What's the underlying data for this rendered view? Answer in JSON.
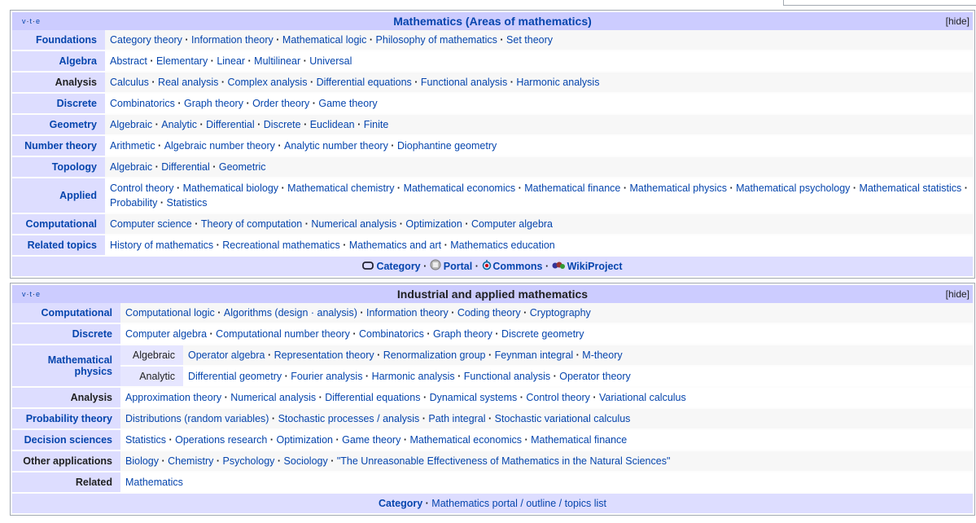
{
  "box1": {
    "vte": [
      "v",
      "t",
      "e"
    ],
    "title_link": "Mathematics",
    "title_rest": " (Areas of mathematics)",
    "hide": "[hide]",
    "rows": [
      {
        "group": "Foundations",
        "group_link": true,
        "items": [
          "Category theory",
          "Information theory",
          "Mathematical logic",
          "Philosophy of mathematics",
          "Set theory"
        ]
      },
      {
        "group": "Algebra",
        "group_link": true,
        "items": [
          "Abstract",
          "Elementary",
          "Linear",
          "Multilinear",
          "Universal"
        ]
      },
      {
        "group": "Analysis",
        "group_link": false,
        "items": [
          "Calculus",
          "Real analysis",
          "Complex analysis",
          "Differential equations",
          "Functional analysis",
          "Harmonic analysis"
        ]
      },
      {
        "group": "Discrete",
        "group_link": true,
        "items": [
          "Combinatorics",
          "Graph theory",
          "Order theory",
          "Game theory"
        ]
      },
      {
        "group": "Geometry",
        "group_link": true,
        "items": [
          "Algebraic",
          "Analytic",
          "Differential",
          "Discrete",
          "Euclidean",
          "Finite"
        ]
      },
      {
        "group": "Number theory",
        "group_link": true,
        "items": [
          "Arithmetic",
          "Algebraic number theory",
          "Analytic number theory",
          "Diophantine geometry"
        ]
      },
      {
        "group": "Topology",
        "group_link": true,
        "items": [
          "Algebraic",
          "Differential",
          "Geometric"
        ]
      },
      {
        "group": "Applied",
        "group_link": true,
        "items": [
          "Control theory",
          "Mathematical biology",
          "Mathematical chemistry",
          "Mathematical economics",
          "Mathematical finance",
          "Mathematical physics",
          "Mathematical psychology",
          "Mathematical statistics",
          "Probability",
          "Statistics"
        ]
      },
      {
        "group": "Computational",
        "group_link": true,
        "items": [
          "Computer science",
          "Theory of computation",
          "Numerical analysis",
          "Optimization",
          "Computer algebra"
        ]
      },
      {
        "group": "Related topics",
        "group_link": true,
        "items": [
          "History of mathematics",
          "Recreational mathematics",
          "Mathematics and art",
          "Mathematics education"
        ]
      }
    ],
    "footer": {
      "category": "Category",
      "portal": "Portal",
      "commons": "Commons",
      "wikiproject": "WikiProject"
    }
  },
  "box2": {
    "vte": [
      "v",
      "t",
      "e"
    ],
    "title": "Industrial and applied mathematics",
    "hide": "[hide]",
    "rows": [
      {
        "group": "Computational",
        "group_link": true,
        "items": [
          "Computational logic",
          "Algorithms (design · analysis)",
          "Information theory",
          "Coding theory",
          "Cryptography"
        ]
      },
      {
        "group": "Discrete",
        "group_link": true,
        "items": [
          "Computer algebra",
          "Computational number theory",
          "Combinatorics",
          "Graph theory",
          "Discrete geometry"
        ]
      },
      {
        "group": "Mathematical physics",
        "group_link": true,
        "subrows": [
          {
            "label": "Algebraic",
            "items": [
              "Operator algebra",
              "Representation theory",
              "Renormalization group",
              "Feynman integral",
              "M-theory"
            ]
          },
          {
            "label": "Analytic",
            "items": [
              "Differential geometry",
              "Fourier analysis",
              "Harmonic analysis",
              "Functional analysis",
              "Operator theory"
            ]
          }
        ]
      },
      {
        "group": "Analysis",
        "group_link": false,
        "items": [
          "Approximation theory",
          "Numerical analysis",
          "Differential equations",
          "Dynamical systems",
          "Control theory",
          "Variational calculus"
        ]
      },
      {
        "group": "Probability theory",
        "group_link": true,
        "items": [
          "Distributions (random variables)",
          "Stochastic processes / analysis",
          "Path integral",
          "Stochastic variational calculus"
        ]
      },
      {
        "group": "Decision sciences",
        "group_link": true,
        "items": [
          "Statistics",
          "Operations research",
          "Optimization",
          "Game theory",
          "Mathematical economics",
          "Mathematical finance"
        ]
      },
      {
        "group": "Other applications",
        "group_link": false,
        "items": [
          "Biology",
          "Chemistry",
          "Psychology",
          "Sociology",
          "\"The Unreasonable Effectiveness of Mathematics in the Natural Sciences\""
        ]
      },
      {
        "group": "Related",
        "group_link": false,
        "items": [
          "Mathematics"
        ]
      }
    ],
    "footer": {
      "category": "Category",
      "rest": "Mathematics portal / outline / topics list"
    }
  },
  "colors": {
    "title_bg": "#ccccff",
    "group_bg": "#ddddff",
    "link": "#0645ad"
  }
}
